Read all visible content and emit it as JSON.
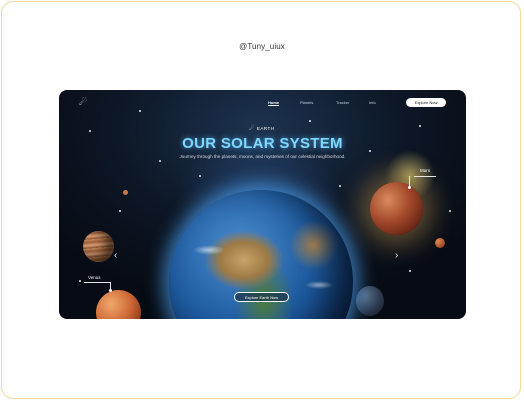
{
  "attribution": {
    "handle": "@Tuny_uiux"
  },
  "nav": {
    "links": [
      {
        "label": "Home",
        "active": true
      },
      {
        "label": "Planets",
        "active": false
      },
      {
        "label": "Tracker",
        "active": false
      },
      {
        "label": "Info",
        "active": false
      }
    ],
    "cta_label": "Explore Now",
    "logo_icon": "planet-logo-icon"
  },
  "hero": {
    "brand": "EARTH",
    "title": "OUR SOLAR SYSTEM",
    "subtitle": "Journey through the planets, moons, and mysteries of our celestial neighborhood.",
    "cta_label": "Explore Earth Now"
  },
  "planets": {
    "mars_label": "Mars",
    "venus_label": "Venus"
  },
  "carousel": {
    "prev_icon": "chevron-left-icon",
    "next_icon": "chevron-right-icon"
  },
  "colors": {
    "accent": "#7fd8ff",
    "background": "#0d1726",
    "card_border": "#f4d9a0"
  }
}
